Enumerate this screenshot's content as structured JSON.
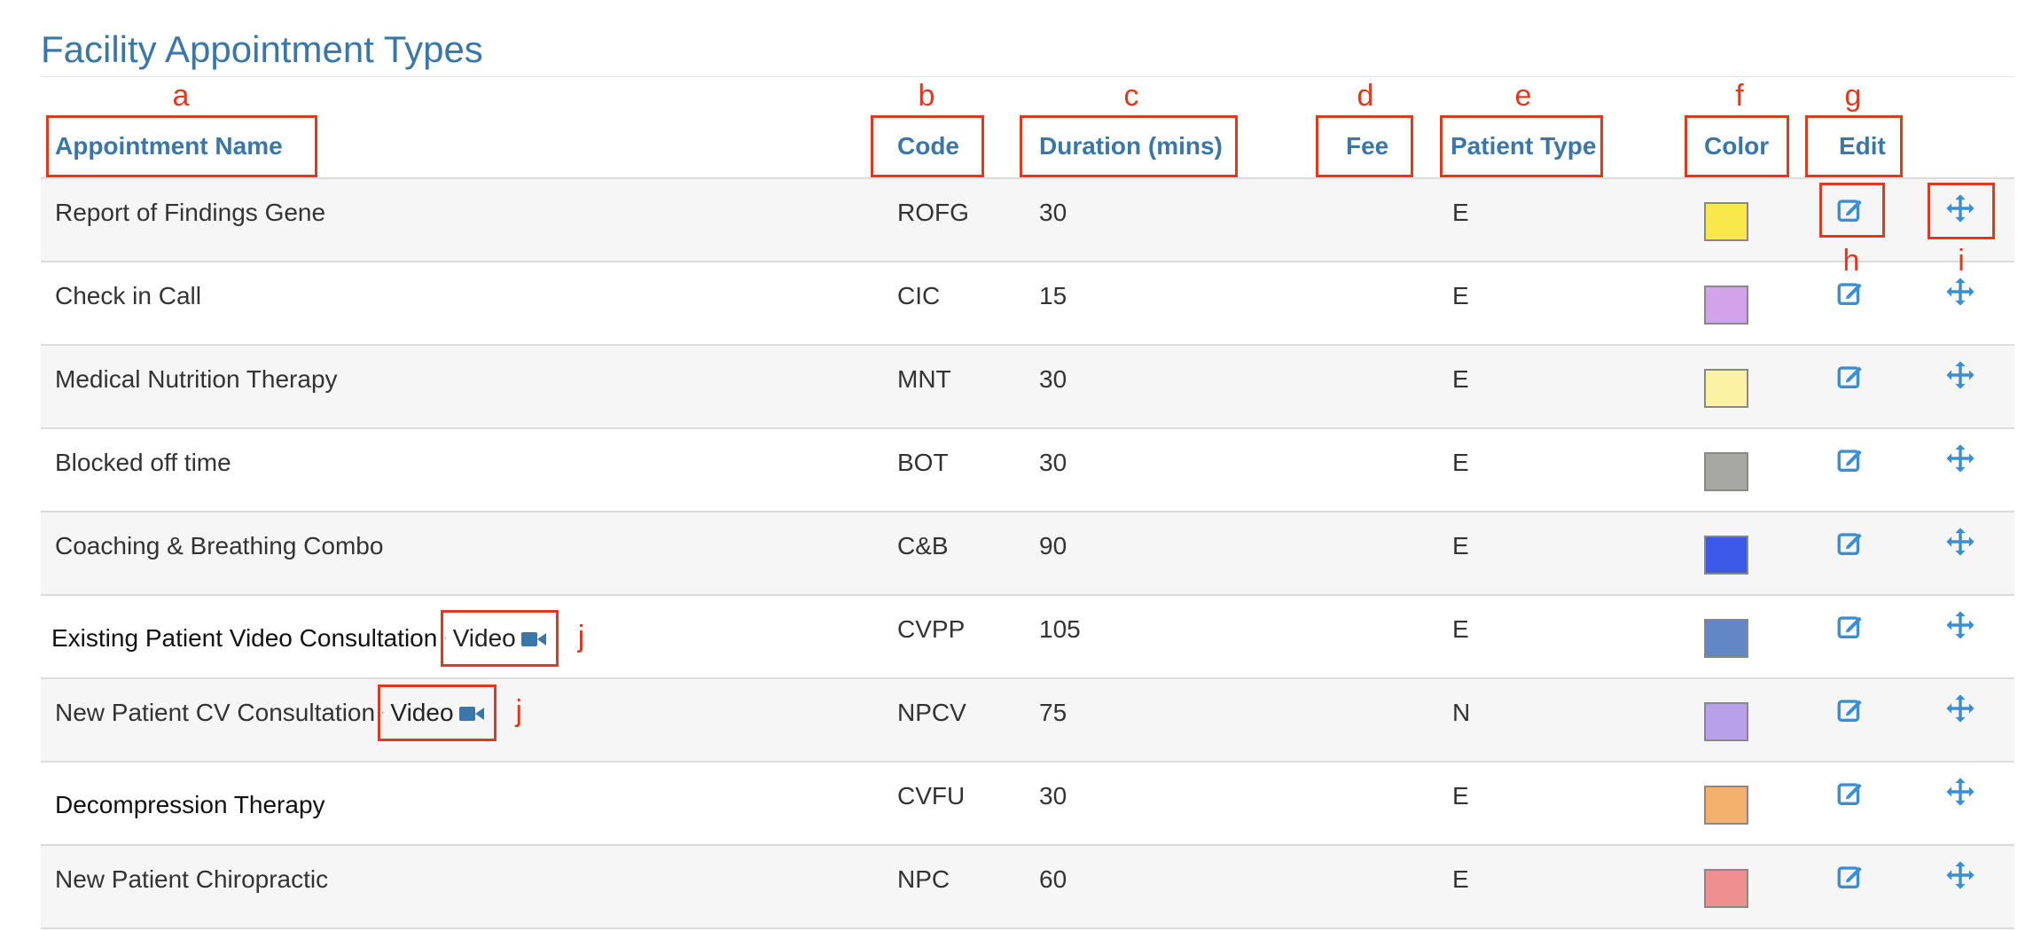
{
  "page": {
    "title": "Facility Appointment Types"
  },
  "annotation_letters": [
    "a",
    "b",
    "c",
    "d",
    "e",
    "f",
    "g"
  ],
  "row_annotation_letters": {
    "edit": "h",
    "move": "i",
    "video": "j"
  },
  "columns": {
    "name": "Appointment Name",
    "code": "Code",
    "duration": "Duration (mins)",
    "fee": "Fee",
    "patient_type": "Patient Type",
    "color": "Color",
    "edit": "Edit"
  },
  "rows": [
    {
      "name": "Report of Findings Gene",
      "code": "ROFG",
      "duration": "30",
      "fee": "",
      "patient_type": "E",
      "color": "#f9e84b",
      "video": ""
    },
    {
      "name": "Check in Call",
      "code": "CIC",
      "duration": "15",
      "fee": "",
      "patient_type": "E",
      "color": "#d3a3ea",
      "video": ""
    },
    {
      "name": "Medical Nutrition Therapy",
      "code": "MNT",
      "duration": "30",
      "fee": "",
      "patient_type": "E",
      "color": "#fbf2a4",
      "video": ""
    },
    {
      "name": "Blocked off time",
      "code": "BOT",
      "duration": "30",
      "fee": "",
      "patient_type": "E",
      "color": "#a7a7a3",
      "video": ""
    },
    {
      "name": "Coaching & Breathing Combo",
      "code": "C&B",
      "duration": "90",
      "fee": "",
      "patient_type": "E",
      "color": "#3b59e6",
      "video": ""
    },
    {
      "name": "Existing Patient Video Consultation",
      "code": "CVPP",
      "duration": "105",
      "fee": "",
      "patient_type": "E",
      "color": "#6387c4",
      "video": "Video"
    },
    {
      "name": "New Patient CV Consultation",
      "code": "NPCV",
      "duration": "75",
      "fee": "",
      "patient_type": "N",
      "color": "#b9a0ea",
      "video": "Video"
    },
    {
      "name": "Decompression Therapy",
      "code": "CVFU",
      "duration": "30",
      "fee": "",
      "patient_type": "E",
      "color": "#f4b16e",
      "video": ""
    },
    {
      "name": "New Patient Chiropractic",
      "code": "NPC",
      "duration": "60",
      "fee": "",
      "patient_type": "E",
      "color": "#ee9090",
      "video": ""
    }
  ],
  "colors": {
    "accent": "#3a77a8",
    "annotation": "#e03a1e",
    "row_stripe": "#f6f6f6"
  },
  "icons": {
    "edit": "edit-icon",
    "move": "move-icon",
    "video": "video-camera-icon"
  }
}
